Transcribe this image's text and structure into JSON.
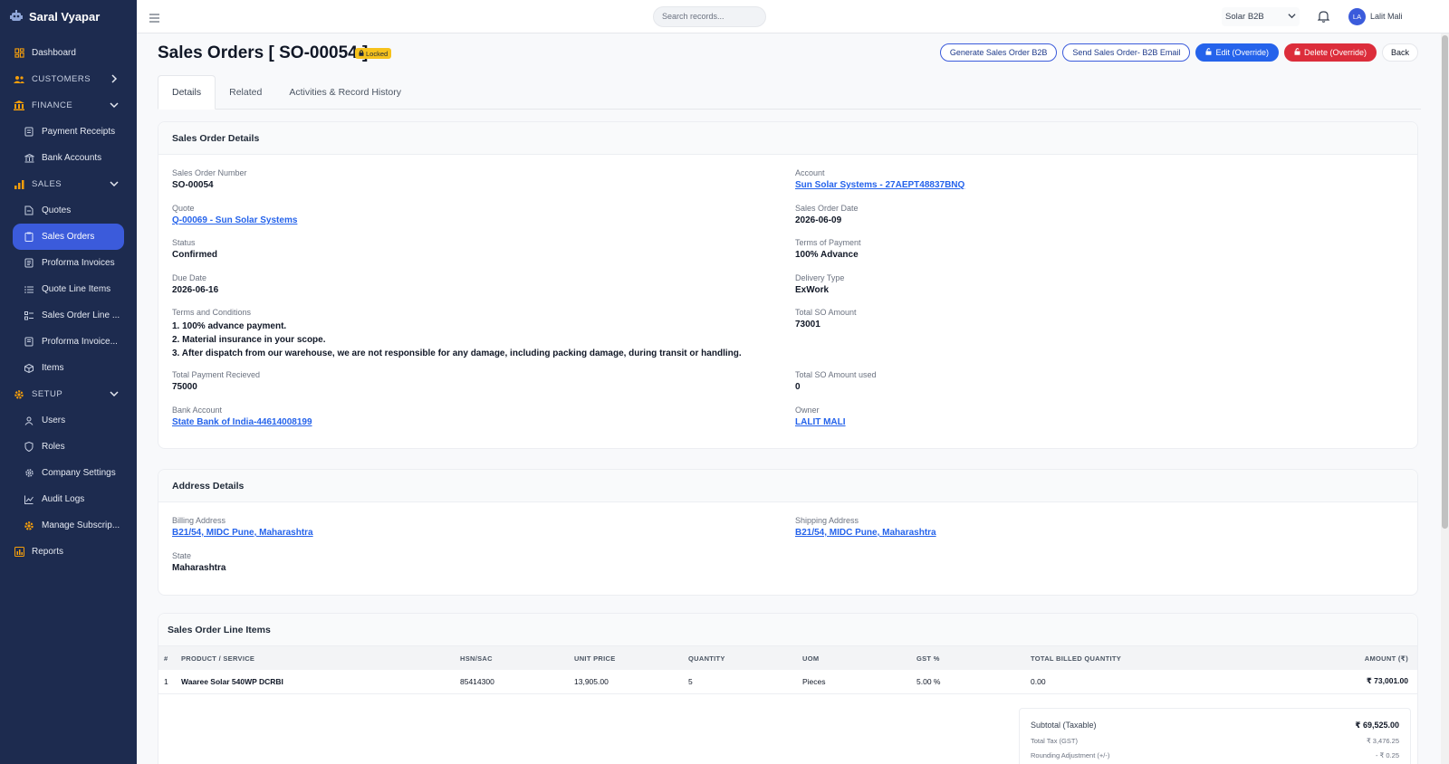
{
  "app": {
    "name": "Saral Vyapar"
  },
  "sidebar": {
    "items": [
      {
        "label": "Dashboard"
      },
      {
        "label": "CUSTOMERS"
      },
      {
        "label": "FINANCE"
      },
      {
        "label": "Payment Receipts"
      },
      {
        "label": "Bank Accounts"
      },
      {
        "label": "SALES"
      },
      {
        "label": "Quotes"
      },
      {
        "label": "Sales Orders"
      },
      {
        "label": "Proforma Invoices"
      },
      {
        "label": "Quote Line Items"
      },
      {
        "label": "Sales Order Line ..."
      },
      {
        "label": "Proforma Invoice..."
      },
      {
        "label": "Items"
      },
      {
        "label": "SETUP"
      },
      {
        "label": "Users"
      },
      {
        "label": "Roles"
      },
      {
        "label": "Company Settings"
      },
      {
        "label": "Audit Logs"
      },
      {
        "label": "Manage Subscrip..."
      },
      {
        "label": "Reports"
      }
    ]
  },
  "topbar": {
    "search_placeholder": "Search records...",
    "org": "Solar B2B",
    "user_initials": "LA",
    "user_name": "Lalit Mali"
  },
  "page": {
    "title": "Sales Orders [ SO-00054 ]",
    "badge": "Locked",
    "actions": {
      "generate": "Generate Sales Order B2B",
      "send": "Send Sales Order- B2B Email",
      "edit": "Edit (Override)",
      "delete": "Delete (Override)",
      "back": "Back"
    },
    "tabs": [
      "Details",
      "Related",
      "Activities & Record History"
    ]
  },
  "details": {
    "heading": "Sales Order Details",
    "left": [
      {
        "label": "Sales Order Number",
        "value": "SO-00054"
      },
      {
        "label": "Quote",
        "value": "Q-00069 - Sun Solar Systems"
      },
      {
        "label": "Status",
        "value": "Confirmed"
      },
      {
        "label": "Due Date",
        "value": "2026-06-16"
      },
      {
        "label": "Terms and Conditions",
        "lines": [
          "1. 100% advance payment.",
          "2. Material insurance in your scope.",
          "3. After dispatch from our warehouse, we are not responsible for any damage, including packing damage, during transit or handling."
        ]
      },
      {
        "label": "Total Payment Recieved",
        "value": "75000"
      },
      {
        "label": "Bank Account",
        "value": "State Bank of India-44614008199"
      }
    ],
    "right": [
      {
        "label": "Account",
        "value": "Sun Solar Systems - 27AEPT48837BNQ"
      },
      {
        "label": "Sales Order Date",
        "value": "2026-06-09"
      },
      {
        "label": "Terms of Payment",
        "value": "100% Advance"
      },
      {
        "label": "Delivery Type",
        "value": "ExWork"
      },
      {
        "label": "Total SO Amount",
        "value": "73001"
      },
      {
        "label": "Total SO Amount used",
        "value": "0"
      },
      {
        "label": "Owner",
        "value": "LALIT MALI"
      }
    ]
  },
  "address": {
    "heading": "Address Details",
    "billing_label": "Billing Address",
    "billing": "B21/54, MIDC Pune, Maharashtra",
    "shipping_label": "Shipping Address",
    "shipping": "B21/54, MIDC Pune, Maharashtra",
    "state_label": "State",
    "state": "Maharashtra"
  },
  "line_items": {
    "heading": "Sales Order Line Items",
    "columns": [
      "#",
      "PRODUCT / SERVICE",
      "HSN/SAC",
      "UNIT PRICE",
      "QUANTITY",
      "UOM",
      "GST %",
      "TOTAL BILLED QUANTITY",
      "AMOUNT (₹)"
    ],
    "rows": [
      [
        "1",
        "Waaree Solar 540WP DCRBI",
        "85414300",
        "13,905.00",
        "5",
        "Pieces",
        "5.00 %",
        "0.00",
        "₹ 73,001.00"
      ]
    ],
    "totals": [
      {
        "label": "Subtotal (Taxable)",
        "value": "₹ 69,525.00"
      },
      {
        "label": "Total Tax (GST)",
        "value": "₹ 3,476.25"
      },
      {
        "label": "Rounding Adjustment (+/-)",
        "value": "- ₹ 0.25"
      }
    ]
  }
}
